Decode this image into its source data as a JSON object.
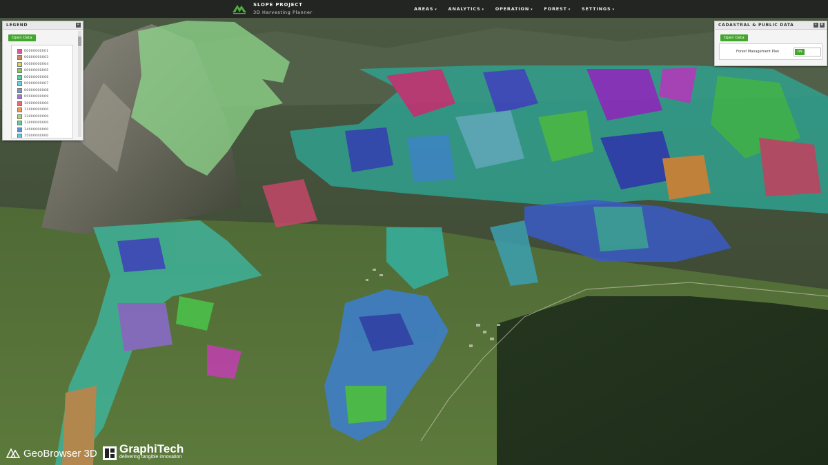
{
  "header": {
    "app_title": "SLOPE PROJECT",
    "app_subtitle": "3D Harvesting Planner",
    "menu": [
      {
        "label": "AREAS"
      },
      {
        "label": "ANALYTICS"
      },
      {
        "label": "OPERATION"
      },
      {
        "label": "FOREST"
      },
      {
        "label": "SETTINGS"
      }
    ],
    "menu_caret": "▾"
  },
  "legend_panel": {
    "title": "LEGEND",
    "minimize_label": "–",
    "open_data_label": "Open Data",
    "items": [
      {
        "label": "00000000001",
        "color": "#d85a9a"
      },
      {
        "label": "00000000003",
        "color": "#c98a5a"
      },
      {
        "label": "00000000004",
        "color": "#d6d65a"
      },
      {
        "label": "00000000005",
        "color": "#7ccf5a"
      },
      {
        "label": "00000000006",
        "color": "#5ec9a3"
      },
      {
        "label": "00000000007",
        "color": "#6fd0cf"
      },
      {
        "label": "00000000008",
        "color": "#7a93d4"
      },
      {
        "label": "05000000009",
        "color": "#9a7ad4"
      },
      {
        "label": "10000000000",
        "color": "#e07070"
      },
      {
        "label": "11000000000",
        "color": "#e59a5a"
      },
      {
        "label": "12000000000",
        "color": "#a6d86a"
      },
      {
        "label": "13000000000",
        "color": "#68c9a0"
      },
      {
        "label": "14000000000",
        "color": "#5f8ed8"
      },
      {
        "label": "15000000000",
        "color": "#5ec9d6"
      }
    ]
  },
  "cadastral_panel": {
    "title": "CADASTRAL & PUBLIC DATA",
    "minimize_label": "–",
    "close_label": "×",
    "open_data_label": "Open Data",
    "layer_label": "Forest Management Plan",
    "toggle_state": "ON"
  },
  "footer": {
    "geobrowser_label": "GeoBrowser 3D",
    "graphitech_label": "GraphiTech",
    "graphitech_tagline": "delivering tangible innovation"
  },
  "colors": {
    "accent_green": "#43a62e",
    "topbar_bg": "#1c1e1e"
  }
}
